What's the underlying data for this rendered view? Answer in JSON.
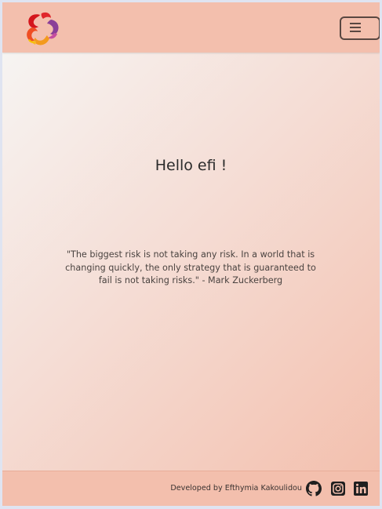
{
  "header": {
    "logo_icon": "pinwheel-logo-icon",
    "menu_icon": "hamburger-menu-icon"
  },
  "main": {
    "greeting": "Hello efi !",
    "quote": "\"The biggest risk is not taking any risk. In a world that is changing quickly, the only strategy that is guaranteed to fail is not taking risks.\" - Mark Zuckerberg"
  },
  "footer": {
    "credit": "Developed by Efthymia Kakoulidou",
    "social_icons": [
      "github-icon",
      "instagram-icon",
      "linkedin-icon"
    ]
  },
  "colors": {
    "bar_background": "#f3bfad",
    "gradient_start": "#f6f4f2",
    "gradient_end": "#f3c0ae",
    "text_dark": "#2b2b2b"
  }
}
